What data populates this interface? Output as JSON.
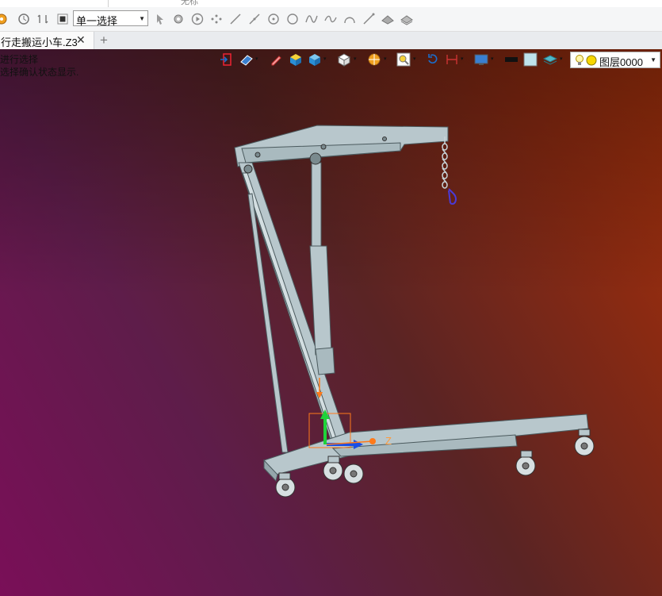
{
  "app": {
    "top_label": "无标",
    "toolbar": {
      "selection_filter": "单一选择",
      "icons": [
        "settings-icon",
        "history-icon",
        "undo-redo-icon",
        "stop-icon",
        "pointer-icon",
        "pick-icon",
        "play-icon",
        "point-icon",
        "line-icon",
        "line2-icon",
        "circle-center-icon",
        "circle-icon",
        "spline-icon",
        "curve-icon",
        "arc-icon",
        "line3-icon",
        "surface-icon",
        "surface2-icon"
      ]
    },
    "tab": {
      "name": "行走搬运小车.Z3",
      "close": "✕",
      "add": "+"
    }
  },
  "viewport": {
    "prompt_line1": "进行选择",
    "prompt_line2": "选择确认状态显示.",
    "layer": {
      "name": "图层0000"
    },
    "axis_label": "Z",
    "colors": {
      "model": "#b8c7cc",
      "edge": "#4b5a5e",
      "accent": "#ff7a1a"
    }
  }
}
